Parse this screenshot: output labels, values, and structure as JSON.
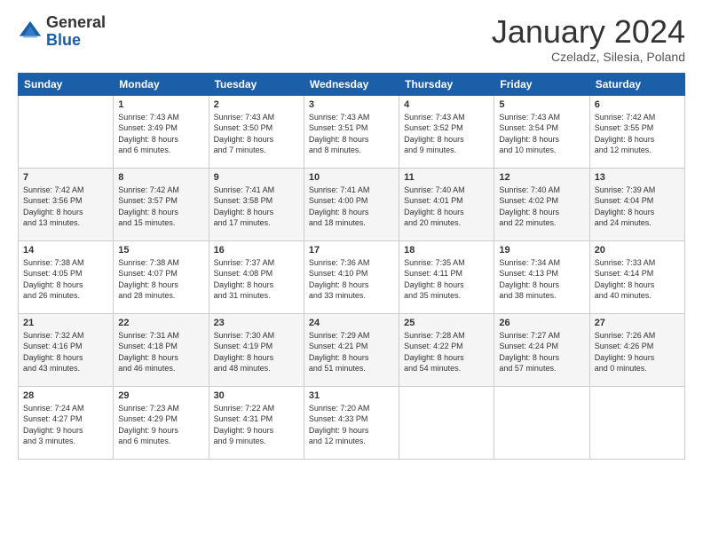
{
  "logo": {
    "general": "General",
    "blue": "Blue"
  },
  "header": {
    "month": "January 2024",
    "location": "Czeladz, Silesia, Poland"
  },
  "weekdays": [
    "Sunday",
    "Monday",
    "Tuesday",
    "Wednesday",
    "Thursday",
    "Friday",
    "Saturday"
  ],
  "weeks": [
    [
      {
        "day": "",
        "info": ""
      },
      {
        "day": "1",
        "info": "Sunrise: 7:43 AM\nSunset: 3:49 PM\nDaylight: 8 hours\nand 6 minutes."
      },
      {
        "day": "2",
        "info": "Sunrise: 7:43 AM\nSunset: 3:50 PM\nDaylight: 8 hours\nand 7 minutes."
      },
      {
        "day": "3",
        "info": "Sunrise: 7:43 AM\nSunset: 3:51 PM\nDaylight: 8 hours\nand 8 minutes."
      },
      {
        "day": "4",
        "info": "Sunrise: 7:43 AM\nSunset: 3:52 PM\nDaylight: 8 hours\nand 9 minutes."
      },
      {
        "day": "5",
        "info": "Sunrise: 7:43 AM\nSunset: 3:54 PM\nDaylight: 8 hours\nand 10 minutes."
      },
      {
        "day": "6",
        "info": "Sunrise: 7:42 AM\nSunset: 3:55 PM\nDaylight: 8 hours\nand 12 minutes."
      }
    ],
    [
      {
        "day": "7",
        "info": "Sunrise: 7:42 AM\nSunset: 3:56 PM\nDaylight: 8 hours\nand 13 minutes."
      },
      {
        "day": "8",
        "info": "Sunrise: 7:42 AM\nSunset: 3:57 PM\nDaylight: 8 hours\nand 15 minutes."
      },
      {
        "day": "9",
        "info": "Sunrise: 7:41 AM\nSunset: 3:58 PM\nDaylight: 8 hours\nand 17 minutes."
      },
      {
        "day": "10",
        "info": "Sunrise: 7:41 AM\nSunset: 4:00 PM\nDaylight: 8 hours\nand 18 minutes."
      },
      {
        "day": "11",
        "info": "Sunrise: 7:40 AM\nSunset: 4:01 PM\nDaylight: 8 hours\nand 20 minutes."
      },
      {
        "day": "12",
        "info": "Sunrise: 7:40 AM\nSunset: 4:02 PM\nDaylight: 8 hours\nand 22 minutes."
      },
      {
        "day": "13",
        "info": "Sunrise: 7:39 AM\nSunset: 4:04 PM\nDaylight: 8 hours\nand 24 minutes."
      }
    ],
    [
      {
        "day": "14",
        "info": "Sunrise: 7:38 AM\nSunset: 4:05 PM\nDaylight: 8 hours\nand 26 minutes."
      },
      {
        "day": "15",
        "info": "Sunrise: 7:38 AM\nSunset: 4:07 PM\nDaylight: 8 hours\nand 28 minutes."
      },
      {
        "day": "16",
        "info": "Sunrise: 7:37 AM\nSunset: 4:08 PM\nDaylight: 8 hours\nand 31 minutes."
      },
      {
        "day": "17",
        "info": "Sunrise: 7:36 AM\nSunset: 4:10 PM\nDaylight: 8 hours\nand 33 minutes."
      },
      {
        "day": "18",
        "info": "Sunrise: 7:35 AM\nSunset: 4:11 PM\nDaylight: 8 hours\nand 35 minutes."
      },
      {
        "day": "19",
        "info": "Sunrise: 7:34 AM\nSunset: 4:13 PM\nDaylight: 8 hours\nand 38 minutes."
      },
      {
        "day": "20",
        "info": "Sunrise: 7:33 AM\nSunset: 4:14 PM\nDaylight: 8 hours\nand 40 minutes."
      }
    ],
    [
      {
        "day": "21",
        "info": "Sunrise: 7:32 AM\nSunset: 4:16 PM\nDaylight: 8 hours\nand 43 minutes."
      },
      {
        "day": "22",
        "info": "Sunrise: 7:31 AM\nSunset: 4:18 PM\nDaylight: 8 hours\nand 46 minutes."
      },
      {
        "day": "23",
        "info": "Sunrise: 7:30 AM\nSunset: 4:19 PM\nDaylight: 8 hours\nand 48 minutes."
      },
      {
        "day": "24",
        "info": "Sunrise: 7:29 AM\nSunset: 4:21 PM\nDaylight: 8 hours\nand 51 minutes."
      },
      {
        "day": "25",
        "info": "Sunrise: 7:28 AM\nSunset: 4:22 PM\nDaylight: 8 hours\nand 54 minutes."
      },
      {
        "day": "26",
        "info": "Sunrise: 7:27 AM\nSunset: 4:24 PM\nDaylight: 8 hours\nand 57 minutes."
      },
      {
        "day": "27",
        "info": "Sunrise: 7:26 AM\nSunset: 4:26 PM\nDaylight: 9 hours\nand 0 minutes."
      }
    ],
    [
      {
        "day": "28",
        "info": "Sunrise: 7:24 AM\nSunset: 4:27 PM\nDaylight: 9 hours\nand 3 minutes."
      },
      {
        "day": "29",
        "info": "Sunrise: 7:23 AM\nSunset: 4:29 PM\nDaylight: 9 hours\nand 6 minutes."
      },
      {
        "day": "30",
        "info": "Sunrise: 7:22 AM\nSunset: 4:31 PM\nDaylight: 9 hours\nand 9 minutes."
      },
      {
        "day": "31",
        "info": "Sunrise: 7:20 AM\nSunset: 4:33 PM\nDaylight: 9 hours\nand 12 minutes."
      },
      {
        "day": "",
        "info": ""
      },
      {
        "day": "",
        "info": ""
      },
      {
        "day": "",
        "info": ""
      }
    ]
  ]
}
